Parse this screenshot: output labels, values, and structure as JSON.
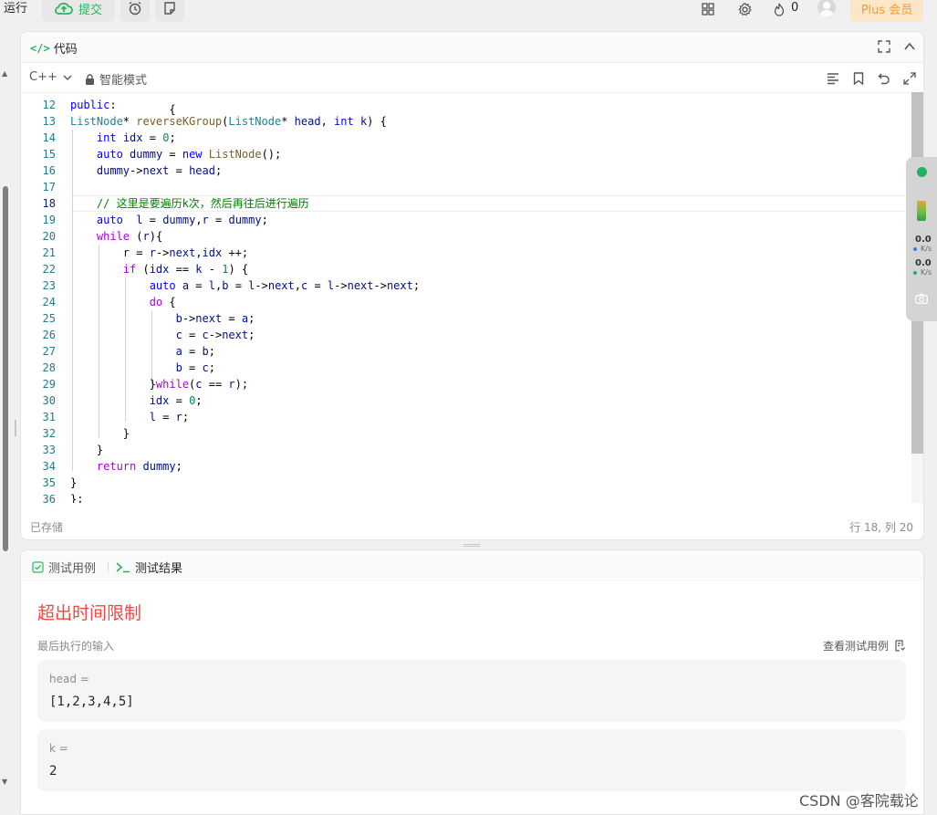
{
  "topbar": {
    "run_label": "运行",
    "submit_label": "提交",
    "streak_count": "0",
    "plus_label": "Plus 会员",
    "icons": [
      "alarm-icon",
      "note-icon",
      "layout-icon",
      "settings-icon",
      "fire-icon",
      "avatar"
    ]
  },
  "code_panel": {
    "title": "代码",
    "language": "C++",
    "mode": "智能模式",
    "saved_status": "已存储",
    "cursor_position": "行 18, 列 20",
    "active_line": 18,
    "lines": [
      {
        "n": "12",
        "html": "<span class=\"kw\">public</span>:"
      },
      {
        "n": "13",
        "html": "<span class=\"ty\">ListNode</span>* <span class=\"fn\">reverseKGroup</span>(<span class=\"ty\">ListNode</span>* <span class=\"var\">head</span>, <span class=\"kw\">int</span> <span class=\"var\">k</span>) {"
      },
      {
        "n": "14",
        "html": "    <span class=\"kw\">int</span> <span class=\"var\">idx</span> = <span class=\"num\">0</span>;"
      },
      {
        "n": "15",
        "html": "    <span class=\"kw\">auto</span> <span class=\"var\">dummy</span> = <span class=\"kw\">new</span> <span class=\"fn\">ListNode</span>();"
      },
      {
        "n": "16",
        "html": "    <span class=\"var\">dummy</span>-&gt;<span class=\"var\">next</span> = <span class=\"var\">head</span>;"
      },
      {
        "n": "17",
        "html": ""
      },
      {
        "n": "18",
        "html": "    <span class=\"cm\">// 这里是要遍历k次，然后再往后进行遍历</span>"
      },
      {
        "n": "19",
        "html": "    <span class=\"kw\">auto</span>  <span class=\"var\">l</span> = <span class=\"var\">dummy</span>,<span class=\"var\">r</span> = <span class=\"var\">dummy</span>;"
      },
      {
        "n": "20",
        "html": "    <span class=\"kw2\">while</span> (<span class=\"var\">r</span>){"
      },
      {
        "n": "21",
        "html": "        <span class=\"var\">r</span> = <span class=\"var\">r</span>-&gt;<span class=\"var\">next</span>,<span class=\"var\">idx</span> ++;"
      },
      {
        "n": "22",
        "html": "        <span class=\"kw2\">if</span> (<span class=\"var\">idx</span> == <span class=\"var\">k</span> - <span class=\"num\">1</span>) {"
      },
      {
        "n": "23",
        "html": "            <span class=\"kw\">auto</span> <span class=\"var\">a</span> = <span class=\"var\">l</span>,<span class=\"var\">b</span> = <span class=\"var\">l</span>-&gt;<span class=\"var\">next</span>,<span class=\"var\">c</span> = <span class=\"var\">l</span>-&gt;<span class=\"var\">next</span>-&gt;<span class=\"var\">next</span>;"
      },
      {
        "n": "24",
        "html": "            <span class=\"kw2\">do</span> {"
      },
      {
        "n": "25",
        "html": "                <span class=\"var\">b</span>-&gt;<span class=\"var\">next</span> = <span class=\"var\">a</span>;"
      },
      {
        "n": "26",
        "html": "                <span class=\"var\">c</span> = <span class=\"var\">c</span>-&gt;<span class=\"var\">next</span>;"
      },
      {
        "n": "27",
        "html": "                <span class=\"var\">a</span> = <span class=\"var\">b</span>;"
      },
      {
        "n": "28",
        "html": "                <span class=\"var\">b</span> = <span class=\"var\">c</span>;"
      },
      {
        "n": "29",
        "html": "            }<span class=\"kw2\">while</span>(<span class=\"var\">c</span> == <span class=\"var\">r</span>);"
      },
      {
        "n": "30",
        "html": "            <span class=\"var\">idx</span> = <span class=\"num\">0</span>;"
      },
      {
        "n": "31",
        "html": "            <span class=\"var\">l</span> = <span class=\"var\">r</span>;"
      },
      {
        "n": "32",
        "html": "        }"
      },
      {
        "n": "33",
        "html": "    }"
      },
      {
        "n": "34",
        "html": "    <span class=\"kw2\">return</span> <span class=\"var\">dummy</span>;"
      },
      {
        "n": "35",
        "html": "}"
      },
      {
        "n": "36",
        "html": "};"
      }
    ]
  },
  "result_panel": {
    "tab_testcase": "测试用例",
    "tab_result": "测试结果",
    "verdict": "超出时间限制",
    "last_input_label": "最后执行的输入",
    "view_testcase_label": "查看测试用例",
    "inputs": [
      {
        "label": "head =",
        "value": "[1,2,3,4,5]"
      },
      {
        "label": "k =",
        "value": "2"
      }
    ]
  },
  "net_widget": {
    "up_value": "0.0",
    "up_unit": "K/s",
    "down_value": "0.0",
    "down_unit": "K/s"
  },
  "watermark": "CSDN @客院载论",
  "colors": {
    "accent_green": "#2db55d",
    "error_red": "#ef4743",
    "plus_orange": "#f29d38"
  }
}
